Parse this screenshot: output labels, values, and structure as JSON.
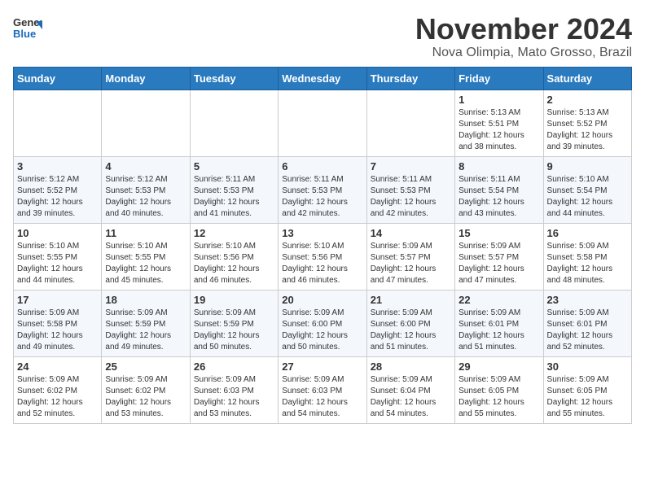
{
  "header": {
    "logo_general": "General",
    "logo_blue": "Blue",
    "month_year": "November 2024",
    "location": "Nova Olimpia, Mato Grosso, Brazil"
  },
  "weekdays": [
    "Sunday",
    "Monday",
    "Tuesday",
    "Wednesday",
    "Thursday",
    "Friday",
    "Saturday"
  ],
  "weeks": [
    [
      {
        "day": "",
        "info": ""
      },
      {
        "day": "",
        "info": ""
      },
      {
        "day": "",
        "info": ""
      },
      {
        "day": "",
        "info": ""
      },
      {
        "day": "",
        "info": ""
      },
      {
        "day": "1",
        "info": "Sunrise: 5:13 AM\nSunset: 5:51 PM\nDaylight: 12 hours\nand 38 minutes."
      },
      {
        "day": "2",
        "info": "Sunrise: 5:13 AM\nSunset: 5:52 PM\nDaylight: 12 hours\nand 39 minutes."
      }
    ],
    [
      {
        "day": "3",
        "info": "Sunrise: 5:12 AM\nSunset: 5:52 PM\nDaylight: 12 hours\nand 39 minutes."
      },
      {
        "day": "4",
        "info": "Sunrise: 5:12 AM\nSunset: 5:53 PM\nDaylight: 12 hours\nand 40 minutes."
      },
      {
        "day": "5",
        "info": "Sunrise: 5:11 AM\nSunset: 5:53 PM\nDaylight: 12 hours\nand 41 minutes."
      },
      {
        "day": "6",
        "info": "Sunrise: 5:11 AM\nSunset: 5:53 PM\nDaylight: 12 hours\nand 42 minutes."
      },
      {
        "day": "7",
        "info": "Sunrise: 5:11 AM\nSunset: 5:53 PM\nDaylight: 12 hours\nand 42 minutes."
      },
      {
        "day": "8",
        "info": "Sunrise: 5:11 AM\nSunset: 5:54 PM\nDaylight: 12 hours\nand 43 minutes."
      },
      {
        "day": "9",
        "info": "Sunrise: 5:10 AM\nSunset: 5:54 PM\nDaylight: 12 hours\nand 44 minutes."
      }
    ],
    [
      {
        "day": "10",
        "info": "Sunrise: 5:10 AM\nSunset: 5:55 PM\nDaylight: 12 hours\nand 44 minutes."
      },
      {
        "day": "11",
        "info": "Sunrise: 5:10 AM\nSunset: 5:55 PM\nDaylight: 12 hours\nand 45 minutes."
      },
      {
        "day": "12",
        "info": "Sunrise: 5:10 AM\nSunset: 5:56 PM\nDaylight: 12 hours\nand 46 minutes."
      },
      {
        "day": "13",
        "info": "Sunrise: 5:10 AM\nSunset: 5:56 PM\nDaylight: 12 hours\nand 46 minutes."
      },
      {
        "day": "14",
        "info": "Sunrise: 5:09 AM\nSunset: 5:57 PM\nDaylight: 12 hours\nand 47 minutes."
      },
      {
        "day": "15",
        "info": "Sunrise: 5:09 AM\nSunset: 5:57 PM\nDaylight: 12 hours\nand 47 minutes."
      },
      {
        "day": "16",
        "info": "Sunrise: 5:09 AM\nSunset: 5:58 PM\nDaylight: 12 hours\nand 48 minutes."
      }
    ],
    [
      {
        "day": "17",
        "info": "Sunrise: 5:09 AM\nSunset: 5:58 PM\nDaylight: 12 hours\nand 49 minutes."
      },
      {
        "day": "18",
        "info": "Sunrise: 5:09 AM\nSunset: 5:59 PM\nDaylight: 12 hours\nand 49 minutes."
      },
      {
        "day": "19",
        "info": "Sunrise: 5:09 AM\nSunset: 5:59 PM\nDaylight: 12 hours\nand 50 minutes."
      },
      {
        "day": "20",
        "info": "Sunrise: 5:09 AM\nSunset: 6:00 PM\nDaylight: 12 hours\nand 50 minutes."
      },
      {
        "day": "21",
        "info": "Sunrise: 5:09 AM\nSunset: 6:00 PM\nDaylight: 12 hours\nand 51 minutes."
      },
      {
        "day": "22",
        "info": "Sunrise: 5:09 AM\nSunset: 6:01 PM\nDaylight: 12 hours\nand 51 minutes."
      },
      {
        "day": "23",
        "info": "Sunrise: 5:09 AM\nSunset: 6:01 PM\nDaylight: 12 hours\nand 52 minutes."
      }
    ],
    [
      {
        "day": "24",
        "info": "Sunrise: 5:09 AM\nSunset: 6:02 PM\nDaylight: 12 hours\nand 52 minutes."
      },
      {
        "day": "25",
        "info": "Sunrise: 5:09 AM\nSunset: 6:02 PM\nDaylight: 12 hours\nand 53 minutes."
      },
      {
        "day": "26",
        "info": "Sunrise: 5:09 AM\nSunset: 6:03 PM\nDaylight: 12 hours\nand 53 minutes."
      },
      {
        "day": "27",
        "info": "Sunrise: 5:09 AM\nSunset: 6:03 PM\nDaylight: 12 hours\nand 54 minutes."
      },
      {
        "day": "28",
        "info": "Sunrise: 5:09 AM\nSunset: 6:04 PM\nDaylight: 12 hours\nand 54 minutes."
      },
      {
        "day": "29",
        "info": "Sunrise: 5:09 AM\nSunset: 6:05 PM\nDaylight: 12 hours\nand 55 minutes."
      },
      {
        "day": "30",
        "info": "Sunrise: 5:09 AM\nSunset: 6:05 PM\nDaylight: 12 hours\nand 55 minutes."
      }
    ]
  ]
}
